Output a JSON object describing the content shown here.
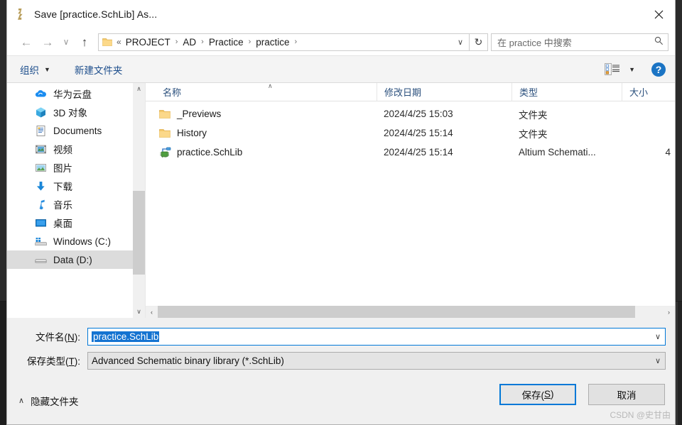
{
  "window": {
    "title": "Save [practice.SchLib] As...",
    "app_icon": "altium-logo-icon",
    "close_label": "✕"
  },
  "nav": {
    "back_icon": "←",
    "forward_icon": "→",
    "recent_icon": "∨",
    "up_icon": "↑",
    "folder_icon": "folder-icon",
    "overflow": "«",
    "breadcrumbs": [
      "PROJECT",
      "AD",
      "Practice",
      "practice"
    ],
    "separator": "›",
    "dropdown_icon": "∨",
    "refresh_icon": "↻"
  },
  "search": {
    "placeholder": "在 practice 中搜索",
    "icon": "search-icon"
  },
  "toolbar": {
    "organize_label": "组织",
    "organize_caret": "▼",
    "new_folder_label": "新建文件夹",
    "view_icon": "details-view-icon",
    "view_caret": "▼",
    "help_icon": "help-icon",
    "help_glyph": "?"
  },
  "sidebar": {
    "items": [
      {
        "label": "华为云盘",
        "icon": "cloud-icon",
        "selected": false
      },
      {
        "label": "3D 对象",
        "icon": "3d-objects-icon",
        "selected": false
      },
      {
        "label": "Documents",
        "icon": "documents-icon",
        "selected": false
      },
      {
        "label": "视频",
        "icon": "videos-icon",
        "selected": false
      },
      {
        "label": "图片",
        "icon": "pictures-icon",
        "selected": false
      },
      {
        "label": "下载",
        "icon": "downloads-icon",
        "selected": false
      },
      {
        "label": "音乐",
        "icon": "music-icon",
        "selected": false
      },
      {
        "label": "桌面",
        "icon": "desktop-icon",
        "selected": false
      },
      {
        "label": "Windows (C:)",
        "icon": "windows-drive-icon",
        "selected": false
      },
      {
        "label": "Data (D:)",
        "icon": "drive-icon",
        "selected": true
      }
    ],
    "scroll_up_icon": "∧",
    "scroll_down_icon": "∨"
  },
  "filelist": {
    "columns": [
      "名称",
      "修改日期",
      "类型",
      "大小"
    ],
    "sort_caret": "∧",
    "rows": [
      {
        "name": "_Previews",
        "icon": "folder-icon",
        "date": "2024/4/25 15:03",
        "type": "文件夹",
        "size": ""
      },
      {
        "name": "History",
        "icon": "folder-icon",
        "date": "2024/4/25 15:14",
        "type": "文件夹",
        "size": ""
      },
      {
        "name": "practice.SchLib",
        "icon": "schlib-file-icon",
        "date": "2024/4/25 15:14",
        "type": "Altium Schemati...",
        "size": "4"
      }
    ],
    "hscroll_left_icon": "‹",
    "hscroll_right_icon": "›"
  },
  "form": {
    "filename_label_pre": "文件名(",
    "filename_label_key": "N",
    "filename_label_post": "):",
    "filename_value": "practice.SchLib",
    "filetype_label_pre": "保存类型(",
    "filetype_label_key": "T",
    "filetype_label_post": "):",
    "filetype_value": "Advanced Schematic binary library (*.SchLib)",
    "dropdown_icon": "∨"
  },
  "footer": {
    "hide_folders_caret": "∧",
    "hide_folders_label": "隐藏文件夹",
    "save_label_pre": "保存(",
    "save_label_key": "S",
    "save_label_post": ")",
    "cancel_label": "取消"
  },
  "watermark": {
    "text": "CSDN @史甘由"
  },
  "colors": {
    "accent": "#0078d7",
    "selection": "#1473d1",
    "link": "#1d4e8c",
    "header_text": "#2a4f7c"
  }
}
